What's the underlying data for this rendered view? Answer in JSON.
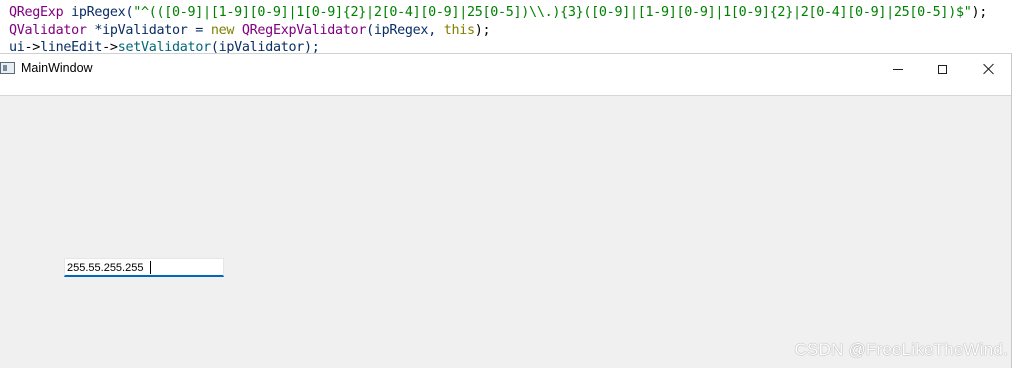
{
  "code": {
    "line1": [
      {
        "t": "QRegExp",
        "c": "type"
      },
      {
        "t": " ipRegex(",
        "c": "var"
      },
      {
        "t": "\"^(([0-9]|[1-9][0-9]|1[0-9]{2}|2[0-4][0-9]|25[0-5])\\\\.){3}([0-9]|[1-9][0-9]|1[0-9]{2}|2[0-4][0-9]|25[0-5])$\"",
        "c": "str"
      },
      {
        "t": ");",
        "c": "plain"
      }
    ],
    "line2": [
      {
        "t": "QValidator",
        "c": "type"
      },
      {
        "t": " *ipValidator = ",
        "c": "var"
      },
      {
        "t": "new",
        "c": "kw"
      },
      {
        "t": " ",
        "c": "plain"
      },
      {
        "t": "QRegExpValidator",
        "c": "type"
      },
      {
        "t": "(ipRegex, ",
        "c": "var"
      },
      {
        "t": "this",
        "c": "kw"
      },
      {
        "t": ");",
        "c": "plain"
      }
    ],
    "line3": [
      {
        "t": "ui",
        "c": "var"
      },
      {
        "t": "->",
        "c": "plain"
      },
      {
        "t": "lineEdit",
        "c": "var"
      },
      {
        "t": "->",
        "c": "plain"
      },
      {
        "t": "setValidator",
        "c": "fn"
      },
      {
        "t": "(ipValidator);",
        "c": "var"
      }
    ]
  },
  "window": {
    "title": "MainWindow",
    "icon": "qt-app-window-icon",
    "controls": {
      "minimize_icon": "minimize-icon",
      "maximize_icon": "maximize-icon",
      "close_icon": "close-icon"
    }
  },
  "line_edit": {
    "value": "255.55.255.255",
    "focus_color": "#0067c0"
  },
  "watermark": "CSDN @FreeLikeTheWind.",
  "colors": {
    "window_bg": "#f0f0f0",
    "titlebar_bg": "#ffffff",
    "code_type": "#800080",
    "code_string": "#008000",
    "code_keyword": "#808000"
  }
}
